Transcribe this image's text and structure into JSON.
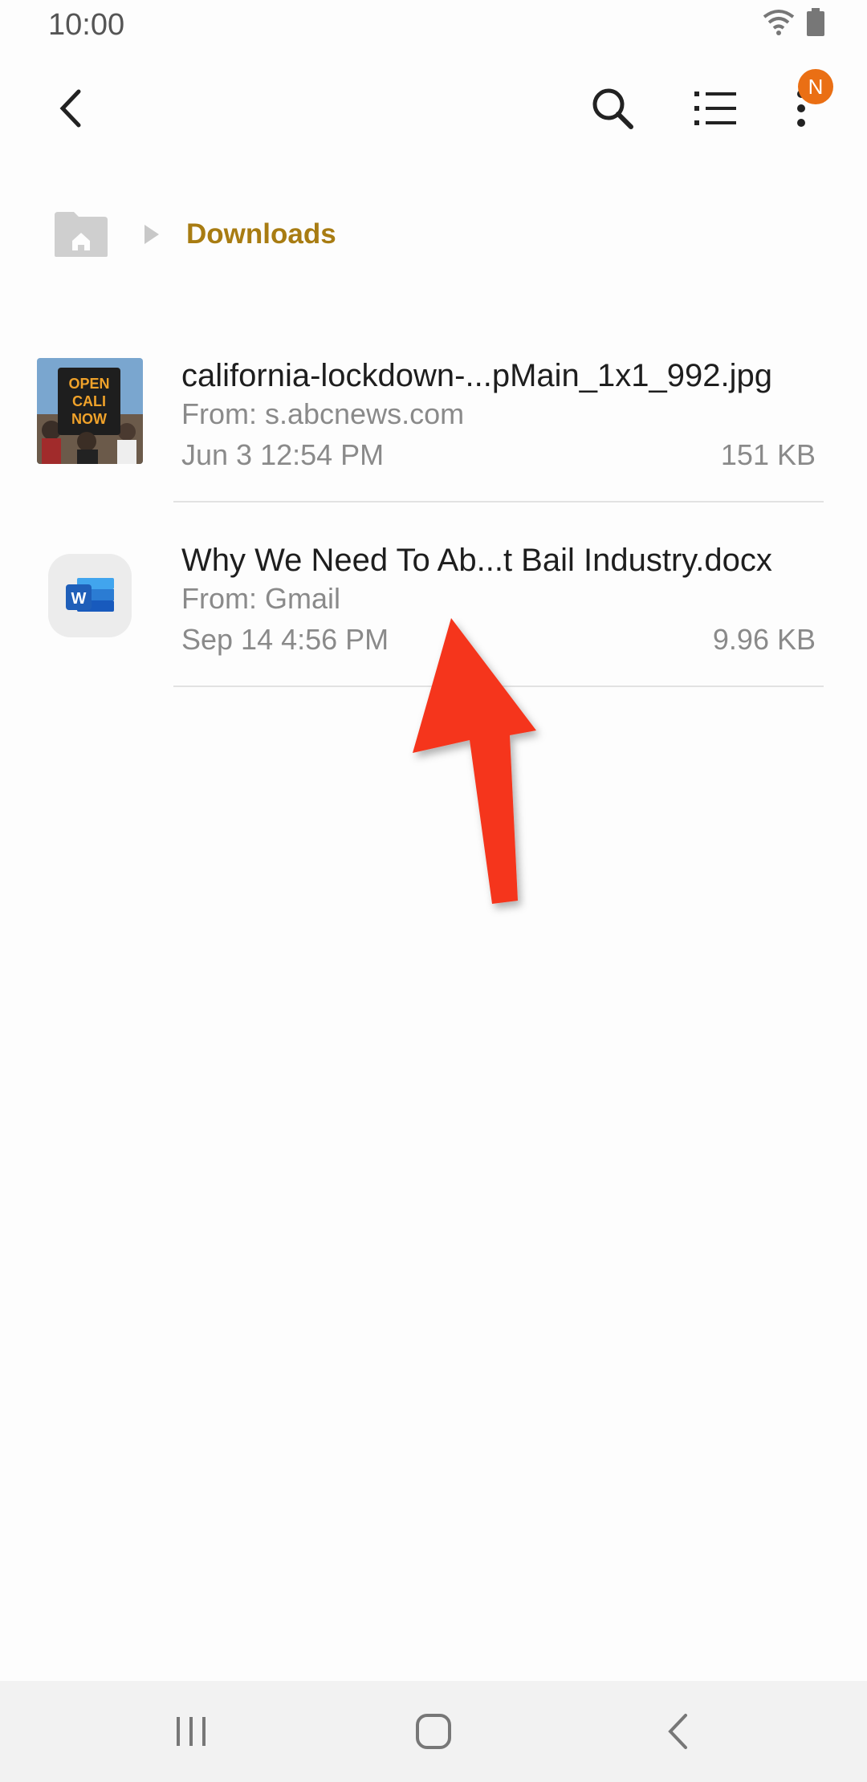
{
  "status_bar": {
    "time": "10:00"
  },
  "app_bar": {
    "badge": "N"
  },
  "breadcrumb": {
    "current": "Downloads"
  },
  "files": [
    {
      "name": "california-lockdown-...pMain_1x1_992.jpg",
      "source": "From: s.abcnews.com",
      "date": "Jun 3 12:54 PM",
      "size": "151 KB",
      "thumb_text": [
        "OPEN",
        "CALI",
        "NOW"
      ]
    },
    {
      "name": "Why We Need To Ab...t Bail Industry.docx",
      "source": "From: Gmail",
      "date": "Sep 14 4:56 PM",
      "size": "9.96 KB",
      "icon_letter": "W"
    }
  ],
  "colors": {
    "accent": "#a87c12",
    "badge": "#ea6f14",
    "arrow": "#f5341b"
  }
}
